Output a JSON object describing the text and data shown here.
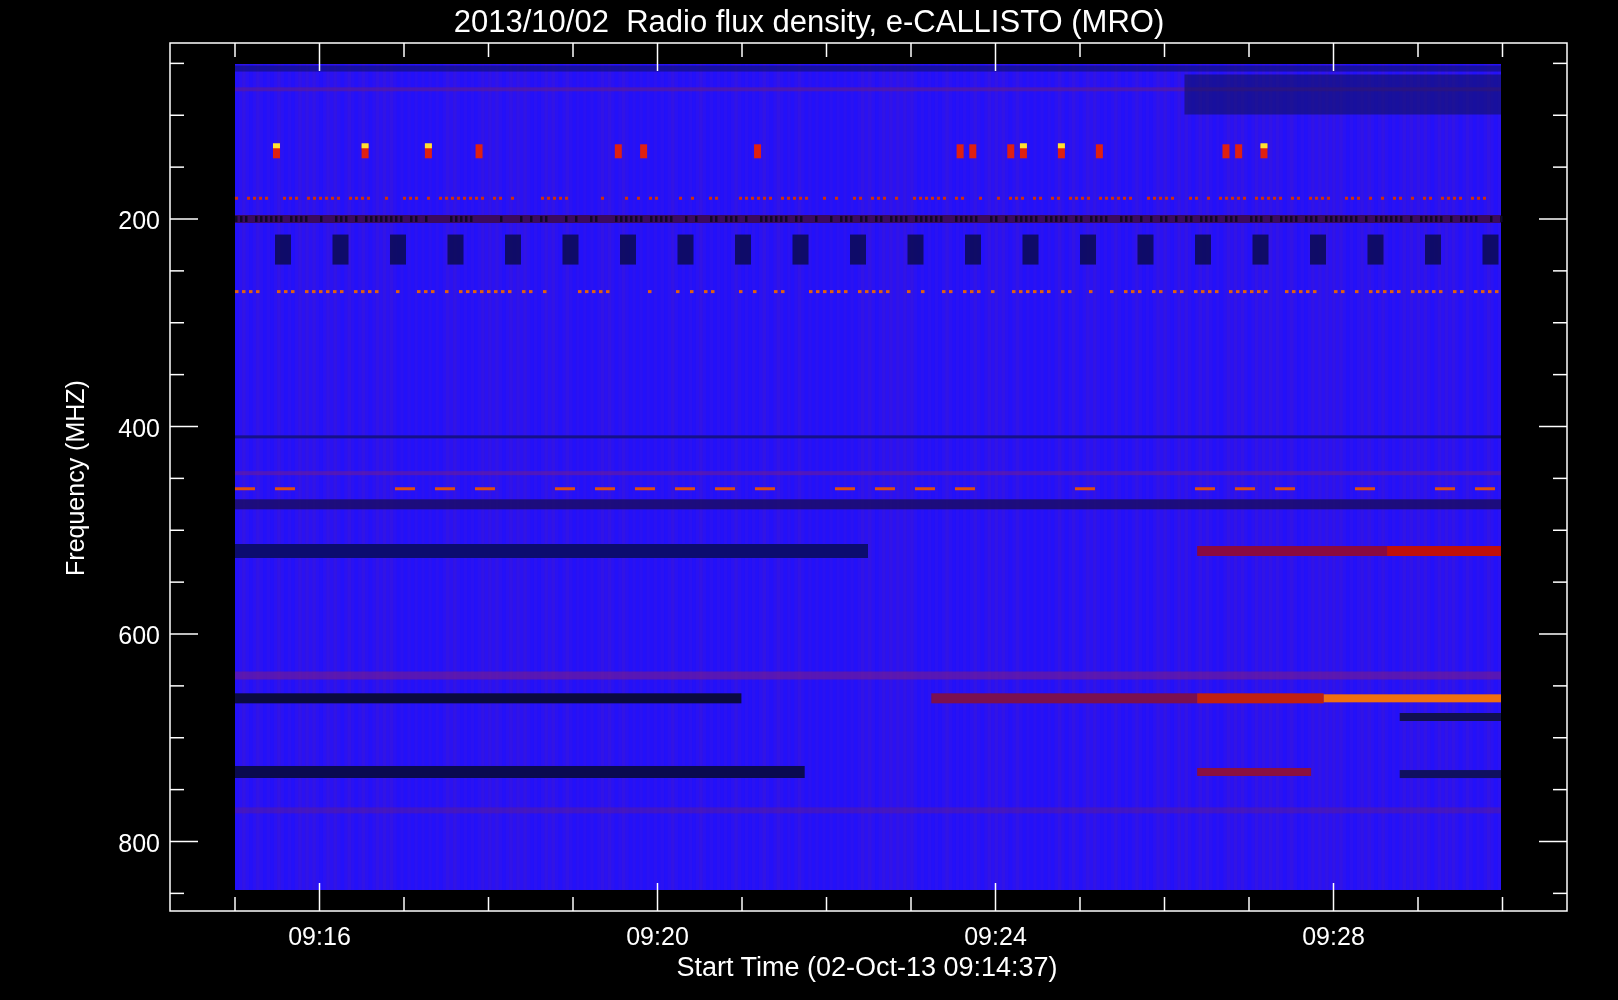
{
  "title": "2013/10/02  Radio flux density, e-CALLISTO (MRO)",
  "y_axis": {
    "label": "Frequency (MHZ)",
    "tick_labels": [
      "200",
      "400",
      "600",
      "800"
    ]
  },
  "x_axis": {
    "label": "Start Time (02-Oct-13 09:14:37)",
    "tick_labels": [
      "09:16",
      "09:20",
      "09:24",
      "09:28"
    ]
  }
}
